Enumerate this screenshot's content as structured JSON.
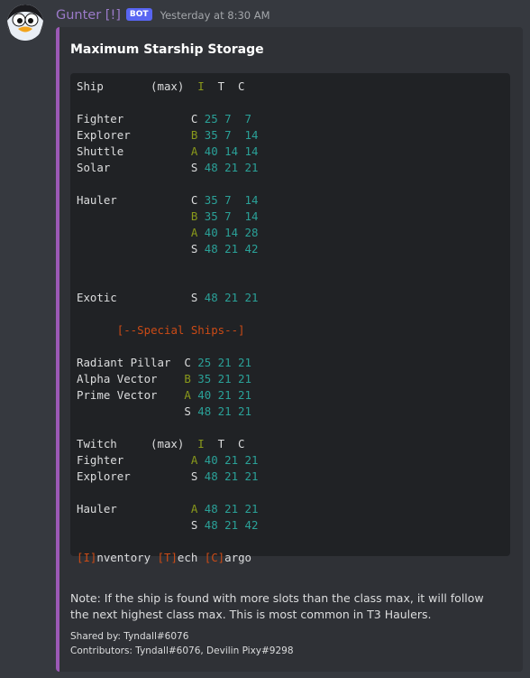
{
  "message": {
    "username": "Gunter [!]",
    "bot_tag": "BOT",
    "timestamp": "Yesterday at 8:30 AM",
    "avatar_icon": "penguin-avatar-icon"
  },
  "embed": {
    "accent_color": "#9b59b6",
    "title": "Maximum Starship Storage",
    "code_lines": [
      [
        {
          "t": "Ship       (max)  "
        },
        {
          "t": "I",
          "c": "y"
        },
        {
          "t": "  T  C"
        }
      ],
      [],
      [
        {
          "t": "Fighter          C "
        },
        {
          "t": "25 7  7",
          "c": "b"
        }
      ],
      [
        {
          "t": "Explorer         "
        },
        {
          "t": "B",
          "c": "y"
        },
        {
          "t": " "
        },
        {
          "t": "35 7  14",
          "c": "b"
        }
      ],
      [
        {
          "t": "Shuttle          "
        },
        {
          "t": "A",
          "c": "y"
        },
        {
          "t": " "
        },
        {
          "t": "40 14 14",
          "c": "b"
        }
      ],
      [
        {
          "t": "Solar            S "
        },
        {
          "t": "48 21 21",
          "c": "b"
        }
      ],
      [],
      [
        {
          "t": "Hauler           C "
        },
        {
          "t": "35 7  14",
          "c": "b"
        }
      ],
      [
        {
          "t": "                 "
        },
        {
          "t": "B",
          "c": "y"
        },
        {
          "t": " "
        },
        {
          "t": "35 7  14",
          "c": "b"
        }
      ],
      [
        {
          "t": "                 "
        },
        {
          "t": "A",
          "c": "y"
        },
        {
          "t": " "
        },
        {
          "t": "40 14 28",
          "c": "b"
        }
      ],
      [
        {
          "t": "                 S "
        },
        {
          "t": "48 21 42",
          "c": "b"
        }
      ],
      [],
      [],
      [
        {
          "t": "Exotic           S "
        },
        {
          "t": "48 21 21",
          "c": "b"
        }
      ],
      [],
      [
        {
          "t": "      "
        },
        {
          "t": "[--Special Ships--]",
          "c": "r"
        }
      ],
      [],
      [
        {
          "t": "Radiant Pillar  C "
        },
        {
          "t": "25 21 21",
          "c": "b"
        }
      ],
      [
        {
          "t": "Alpha Vector    "
        },
        {
          "t": "B",
          "c": "y"
        },
        {
          "t": " "
        },
        {
          "t": "35 21 21",
          "c": "b"
        }
      ],
      [
        {
          "t": "Prime Vector    "
        },
        {
          "t": "A",
          "c": "y"
        },
        {
          "t": " "
        },
        {
          "t": "40 21 21",
          "c": "b"
        }
      ],
      [
        {
          "t": "                S "
        },
        {
          "t": "48 21 21",
          "c": "b"
        }
      ],
      [],
      [
        {
          "t": "Twitch     (max)  "
        },
        {
          "t": "I",
          "c": "y"
        },
        {
          "t": "  T  C"
        }
      ],
      [
        {
          "t": "Fighter          "
        },
        {
          "t": "A",
          "c": "y"
        },
        {
          "t": " "
        },
        {
          "t": "40 21 21",
          "c": "b"
        }
      ],
      [
        {
          "t": "Explorer         S "
        },
        {
          "t": "48 21 21",
          "c": "b"
        }
      ],
      [],
      [
        {
          "t": "Hauler           "
        },
        {
          "t": "A",
          "c": "y"
        },
        {
          "t": " "
        },
        {
          "t": "48 21 21",
          "c": "b"
        }
      ],
      [
        {
          "t": "                 S "
        },
        {
          "t": "48 21 42",
          "c": "b"
        }
      ],
      [],
      [
        {
          "t": "[I]",
          "c": "r"
        },
        {
          "t": "nventory "
        },
        {
          "t": "[T]",
          "c": "r"
        },
        {
          "t": "ech "
        },
        {
          "t": "[C]",
          "c": "r"
        },
        {
          "t": "argo"
        }
      ]
    ],
    "note": "Note: If the ship is found with more slots than the class max, it will follow the next highest class max. This is most common in T3 Haulers.",
    "shared_by": "Shared by: Tyndall#6076",
    "contributors": "Contributors: Tyndall#6076, Devilin Pixy#9298"
  }
}
